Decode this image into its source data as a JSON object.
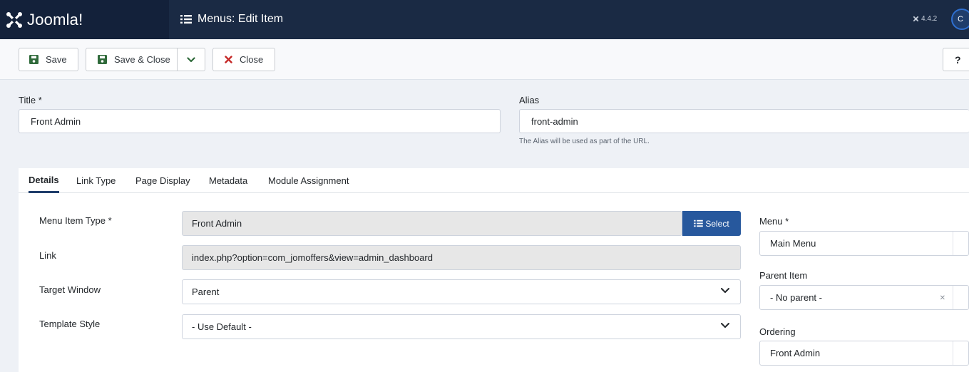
{
  "header": {
    "brand": "Joomla!",
    "page_title": "Menus: Edit Item",
    "version": "4.4.2",
    "user_button_label": "C"
  },
  "toolbar": {
    "save_label": "Save",
    "save_close_label": "Save & Close",
    "close_label": "Close",
    "help_label": "?"
  },
  "form": {
    "title_label": "Title *",
    "title_value": "Front Admin",
    "alias_label": "Alias",
    "alias_value": "front-admin",
    "alias_hint": "The Alias will be used as part of the URL."
  },
  "tabs": [
    {
      "label": "Details",
      "active": true
    },
    {
      "label": "Link Type",
      "active": false
    },
    {
      "label": "Page Display",
      "active": false
    },
    {
      "label": "Metadata",
      "active": false
    },
    {
      "label": "Module Assignment",
      "active": false
    }
  ],
  "details": {
    "menu_item_type_label": "Menu Item Type *",
    "menu_item_type_value": "Front Admin",
    "select_label": "Select",
    "link_label": "Link",
    "link_value": "index.php?option=com_jomoffers&view=admin_dashboard",
    "target_window_label": "Target Window",
    "target_window_value": "Parent",
    "template_style_label": "Template Style",
    "template_style_value": "- Use Default -"
  },
  "sidebar": {
    "menu_label": "Menu *",
    "menu_value": "Main Menu",
    "parent_item_label": "Parent Item",
    "parent_item_value": "- No parent -",
    "ordering_label": "Ordering",
    "ordering_value": "Front Admin"
  },
  "colors": {
    "header_bg": "#1a2a44",
    "brand_bg": "#13213a",
    "primary_button": "#27589d",
    "save_icon": "#2f6a3a",
    "close_icon": "#c52827"
  },
  "icons": {
    "brand": "joomla-logo-icon",
    "title": "list-icon",
    "save": "floppy-icon",
    "caret": "chevron-down-icon",
    "close": "close-icon",
    "select": "list-icon",
    "dropdown": "chevron-down-icon",
    "clear": "clear-x-icon"
  }
}
